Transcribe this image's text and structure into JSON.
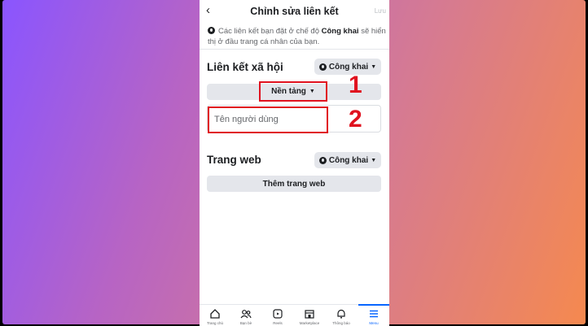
{
  "header": {
    "back_icon": "‹",
    "title": "Chỉnh sửa liên kết",
    "save_label": "Lưu"
  },
  "notice": {
    "prefix": "Các liên kết bạn đặt ở chế độ ",
    "bold": "Công khai",
    "suffix": " sẽ hiển thị ở đầu trang cá nhân của bạn."
  },
  "social": {
    "title": "Liên kết xã hội",
    "privacy": "Công khai",
    "platform_label": "Nền tảng",
    "username_placeholder": "Tên người dùng"
  },
  "website": {
    "title": "Trang web",
    "privacy": "Công khai",
    "add_label": "Thêm trang web"
  },
  "annotations": {
    "step1": "1",
    "step2": "2"
  },
  "tabs": [
    {
      "label": "Trang chủ",
      "icon": "home-icon"
    },
    {
      "label": "Bạn bè",
      "icon": "friends-icon"
    },
    {
      "label": "Reels",
      "icon": "reels-icon"
    },
    {
      "label": "Marketplace",
      "icon": "marketplace-icon"
    },
    {
      "label": "Thông báo",
      "icon": "bell-icon"
    },
    {
      "label": "Menu",
      "icon": "menu-icon"
    }
  ],
  "colors": {
    "accent": "#0866ff",
    "annotation": "#e0121f"
  }
}
